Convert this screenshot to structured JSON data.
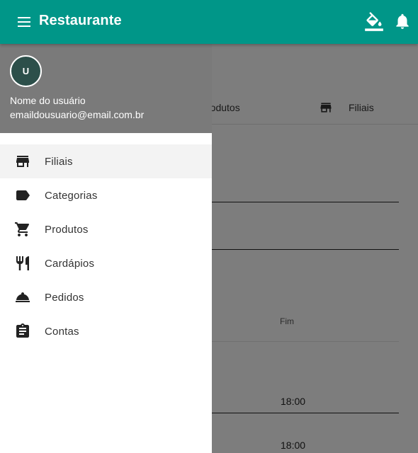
{
  "app": {
    "title": "Restaurante"
  },
  "header_icons": [
    "menu-icon",
    "paint-bucket-icon",
    "bell-icon"
  ],
  "user": {
    "avatar_initial": "U",
    "name": "Nome do usuário",
    "email": "emaildousuario@email.com.br"
  },
  "nav": {
    "items": [
      {
        "label": "Filiais",
        "icon": "store-icon"
      },
      {
        "label": "Categorias",
        "icon": "label-icon"
      },
      {
        "label": "Produtos",
        "icon": "cart-icon"
      },
      {
        "label": "Cardápios",
        "icon": "restaurant-icon"
      },
      {
        "label": "Pedidos",
        "icon": "room-service-icon"
      },
      {
        "label": "Contas",
        "icon": "clipboard-icon"
      }
    ]
  },
  "background": {
    "tabs": {
      "produtos": "rodutos",
      "filiais": "Filiais"
    },
    "table": {
      "col_end": "Fim",
      "row1_end": "18:00",
      "row2_end": "18:00"
    }
  },
  "colors": {
    "primary": "#009688",
    "drawer_header": "#7a7a7a",
    "avatar_bg": "#2c4f4a"
  }
}
